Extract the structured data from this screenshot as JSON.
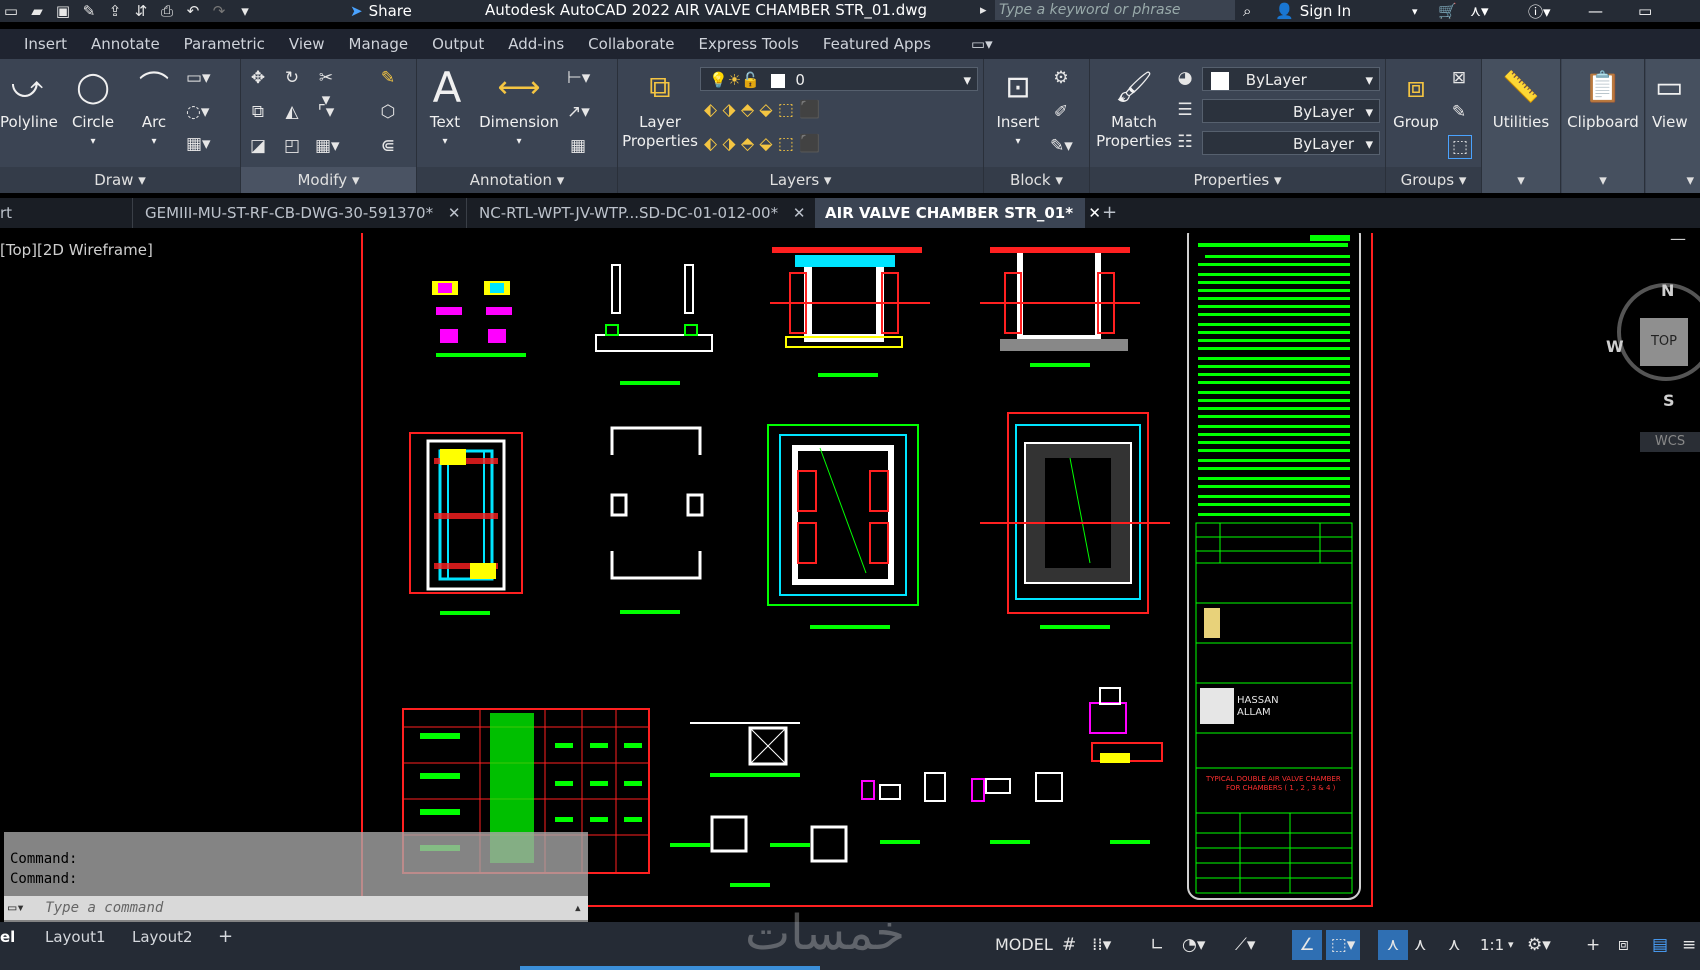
{
  "title_bar": {
    "share_label": "Share",
    "app_title": "Autodesk AutoCAD 2022   AIR VALVE CHAMBER STR_01.dwg",
    "search_placeholder": "Type a keyword or phrase",
    "sign_in_label": "Sign In"
  },
  "menus": [
    "Insert",
    "Annotate",
    "Parametric",
    "View",
    "Manage",
    "Output",
    "Add-ins",
    "Collaborate",
    "Express Tools",
    "Featured Apps"
  ],
  "ribbon": {
    "draw": {
      "title": "Draw",
      "polyline": "Polyline",
      "circle": "Circle",
      "arc": "Arc"
    },
    "modify": {
      "title": "Modify"
    },
    "annotation": {
      "title": "Annotation",
      "text": "Text",
      "dimension": "Dimension"
    },
    "layers": {
      "title": "Layers",
      "layer_properties_1": "Layer",
      "layer_properties_2": "Properties",
      "current_layer": "0"
    },
    "block": {
      "title": "Block",
      "insert": "Insert"
    },
    "properties": {
      "title": "Properties",
      "match_1": "Match",
      "match_2": "Properties",
      "color": "ByLayer",
      "linetype": "ByLayer",
      "lineweight": "ByLayer"
    },
    "groups": {
      "title": "Groups",
      "group": "Group"
    },
    "utilities": {
      "label": "Utilities"
    },
    "clipboard": {
      "label": "Clipboard"
    },
    "view": {
      "label": "View"
    }
  },
  "doc_tabs": {
    "start_partial": "rt",
    "tab1": "GEMIII-MU-ST-RF-CB-DWG-30-591370*",
    "tab2": "NC-RTL-WPT-JV-WTP...SD-DC-01-012-00*",
    "tab3": "AIR VALVE CHAMBER STR_01*"
  },
  "viewport": {
    "label": "[Top][2D Wireframe]"
  },
  "navcube": {
    "top": "TOP",
    "n": "N",
    "s": "S",
    "w": "W",
    "wcs": "WCS"
  },
  "drawing": {
    "company_1": "HASSAN",
    "company_2": "ALLAM",
    "title_1": "TYPICAL DOUBLE AIR VALVE CHAMBER",
    "title_2": "FOR CHAMBERS ( 1 , 2 , 3 & 4 )"
  },
  "command": {
    "line1": "Command:",
    "line2": "Command:",
    "placeholder": "Type  a  command"
  },
  "status": {
    "model_tab_partial": "el",
    "layout1": "Layout1",
    "layout2": "Layout2",
    "model_btn": "MODEL",
    "scale": "1:1"
  },
  "watermark": "خمسات",
  "colors": {
    "accent": "#3b8fd9",
    "titlebar": "#252b35",
    "ribbon": "#3b4453",
    "cad_green": "#00ff00",
    "cad_red": "#ff2020",
    "cad_cyan": "#00e5ff",
    "cad_yellow": "#ffff00",
    "cad_magenta": "#ff00ff"
  }
}
